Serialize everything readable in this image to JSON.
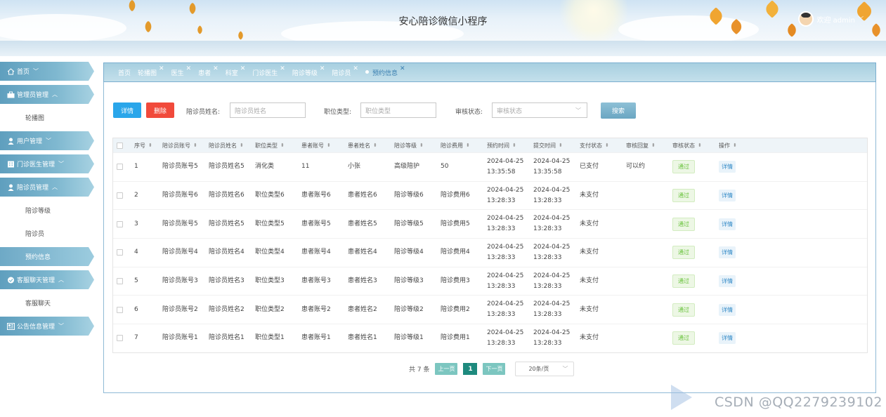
{
  "header": {
    "title": "安心陪诊微信小程序",
    "user_label": "欢迎 admin"
  },
  "sidebar": {
    "items": [
      {
        "label": "首页",
        "type": "menu",
        "icon": "home-icon",
        "chev": "﹀"
      },
      {
        "label": "管理员管理",
        "type": "menu",
        "icon": "briefcase-icon",
        "chev": "︿"
      },
      {
        "label": "轮播图",
        "type": "sub"
      },
      {
        "label": "用户管理",
        "type": "menu",
        "icon": "user-icon",
        "chev": "﹀"
      },
      {
        "label": "门诊医生管理",
        "type": "menu",
        "icon": "building-icon",
        "chev": "﹀"
      },
      {
        "label": "陪诊员管理",
        "type": "menu",
        "icon": "user-icon",
        "chev": "︿"
      },
      {
        "label": "陪诊等级",
        "type": "sub"
      },
      {
        "label": "陪诊员",
        "type": "sub"
      },
      {
        "label": "预约信息",
        "type": "sub",
        "active": true
      },
      {
        "label": "客服聊天管理",
        "type": "menu",
        "icon": "check-circle-icon",
        "chev": "︿"
      },
      {
        "label": "客服聊天",
        "type": "sub"
      },
      {
        "label": "公告信息管理",
        "type": "menu",
        "icon": "news-icon",
        "chev": "﹀"
      }
    ]
  },
  "breadcrumbs": [
    {
      "label": "首页",
      "closable": false
    },
    {
      "label": "轮播图",
      "closable": true
    },
    {
      "label": "医生",
      "closable": true
    },
    {
      "label": "患者",
      "closable": true
    },
    {
      "label": "科室",
      "closable": true
    },
    {
      "label": "门诊医生",
      "closable": true
    },
    {
      "label": "陪诊等级",
      "closable": true
    },
    {
      "label": "陪诊员",
      "closable": true
    },
    {
      "label": "预约信息",
      "closable": true,
      "active": true
    }
  ],
  "close_glyph": "✕",
  "toolbar": {
    "detail_label": "详情",
    "delete_label": "删除",
    "search_label": "搜索",
    "filters": [
      {
        "label": "陪诊员姓名:",
        "placeholder": "陪诊员姓名"
      },
      {
        "label": "职位类型:",
        "placeholder": "职位类型"
      },
      {
        "label": "审核状态:",
        "placeholder": "审核状态"
      }
    ]
  },
  "table": {
    "columns": [
      "序号",
      "陪诊员账号",
      "陪诊员姓名",
      "职位类型",
      "患者账号",
      "患者姓名",
      "陪诊等级",
      "陪诊费用",
      "预约时间",
      "提交时间",
      "支付状态",
      "审核回复",
      "审核状态",
      "操作"
    ],
    "rows": [
      [
        "1",
        "陪诊员账号5",
        "陪诊员姓名5",
        "消化类",
        "11",
        "小张",
        "高级陪护",
        "50",
        "2024-04-25 13:35:58",
        "2024-04-25 13:35:58",
        "已支付",
        "可以约",
        "通过",
        "详情"
      ],
      [
        "2",
        "陪诊员账号6",
        "陪诊员姓名6",
        "职位类型6",
        "患者账号6",
        "患者姓名6",
        "陪诊等级6",
        "陪诊费用6",
        "2024-04-25 13:28:33",
        "2024-04-25 13:28:33",
        "未支付",
        "",
        "通过",
        "详情"
      ],
      [
        "3",
        "陪诊员账号5",
        "陪诊员姓名5",
        "职位类型5",
        "患者账号5",
        "患者姓名5",
        "陪诊等级5",
        "陪诊费用5",
        "2024-04-25 13:28:33",
        "2024-04-25 13:28:33",
        "未支付",
        "",
        "通过",
        "详情"
      ],
      [
        "4",
        "陪诊员账号4",
        "陪诊员姓名4",
        "职位类型4",
        "患者账号4",
        "患者姓名4",
        "陪诊等级4",
        "陪诊费用4",
        "2024-04-25 13:28:33",
        "2024-04-25 13:28:33",
        "未支付",
        "",
        "通过",
        "详情"
      ],
      [
        "5",
        "陪诊员账号3",
        "陪诊员姓名3",
        "职位类型3",
        "患者账号3",
        "患者姓名3",
        "陪诊等级3",
        "陪诊费用3",
        "2024-04-25 13:28:33",
        "2024-04-25 13:28:33",
        "未支付",
        "",
        "通过",
        "详情"
      ],
      [
        "6",
        "陪诊员账号2",
        "陪诊员姓名2",
        "职位类型2",
        "患者账号2",
        "患者姓名2",
        "陪诊等级2",
        "陪诊费用2",
        "2024-04-25 13:28:33",
        "2024-04-25 13:28:33",
        "未支付",
        "",
        "通过",
        "详情"
      ],
      [
        "7",
        "陪诊员账号1",
        "陪诊员姓名1",
        "职位类型1",
        "患者账号1",
        "患者姓名1",
        "陪诊等级1",
        "陪诊费用1",
        "2024-04-25 13:28:33",
        "2024-04-25 13:28:33",
        "未支付",
        "",
        "通过",
        "详情"
      ]
    ]
  },
  "pagination": {
    "total_text": "共 7 条",
    "prev_label": "上一页",
    "current_page": "1",
    "next_label": "下一页",
    "page_size": "20条/页"
  },
  "watermark": "CSDN @QQ2279239102",
  "colors": {
    "accent": "#2aa6ea",
    "danger": "#f14a3b",
    "sidebar": "#7fb8d0",
    "pager": "#1e8a7e"
  }
}
